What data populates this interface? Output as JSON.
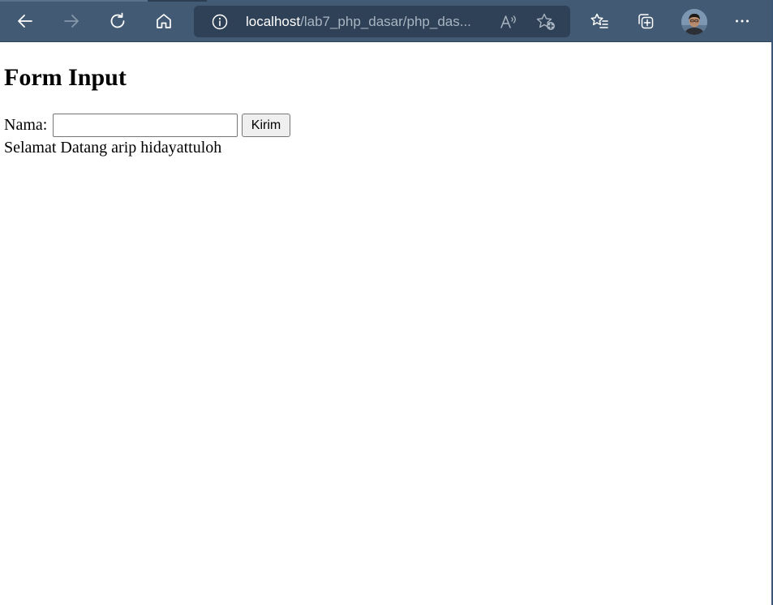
{
  "browser": {
    "address": {
      "host": "localhost",
      "path": "/lab7_php_dasar/php_das..."
    },
    "icons": {
      "back": "arrow-left-icon",
      "forward": "arrow-right-icon",
      "refresh": "refresh-icon",
      "home": "home-icon",
      "site_info": "info-circle-icon",
      "read_aloud": "read-aloud-icon",
      "add_favorite": "star-plus-icon",
      "favorites": "favorites-list-icon",
      "collections": "collections-icon",
      "more": "ellipsis-icon"
    },
    "colors": {
      "toolbar": "#435a74",
      "address_bar": "#2f4156"
    }
  },
  "page": {
    "title": "Form Input",
    "form": {
      "nama_label": "Nama:",
      "nama_value": "",
      "submit_label": "Kirim"
    },
    "welcome_text": "Selamat Datang arip hidayattuloh"
  }
}
